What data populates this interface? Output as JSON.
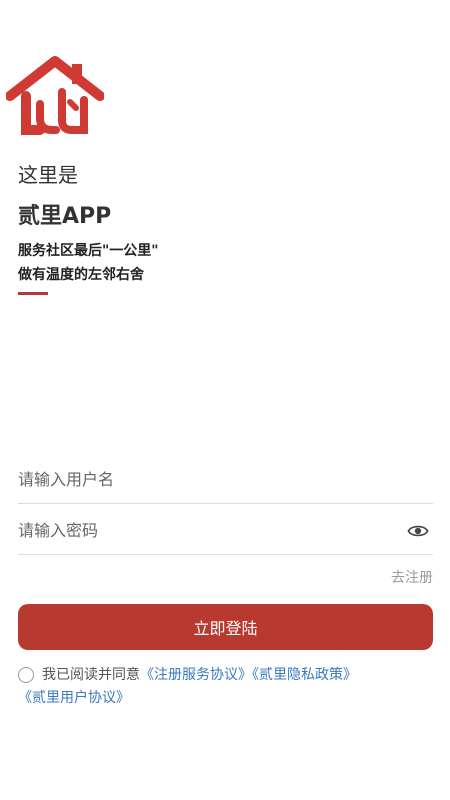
{
  "brand": {
    "logo_icon": "house-logo-icon",
    "accent_color": "#b7392f",
    "intro_line1": "这里是",
    "app_name": "贰里APP",
    "slogan_line1": "服务社区最后\"一公里\"",
    "slogan_line2": "做有温度的左邻右舍"
  },
  "form": {
    "username_placeholder": "请输入用户名",
    "password_placeholder": "请输入密码",
    "password_toggle_icon": "eye-icon",
    "register_label": "去注册",
    "login_label": "立即登陆"
  },
  "agreement": {
    "prefix": "我已阅读并同意",
    "link_service": "《注册服务协议》",
    "link_privacy": "《贰里隐私政策》",
    "link_user": "《贰里用户协议》",
    "link_color": "#3a78c2"
  }
}
